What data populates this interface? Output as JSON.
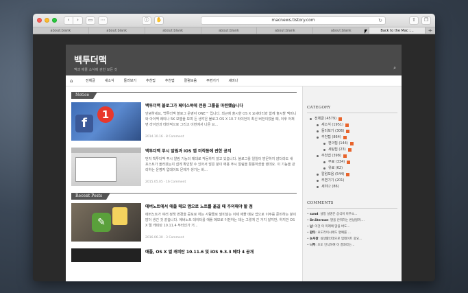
{
  "browser": {
    "address": "macnews.tistory.com",
    "tabs": [
      "about:blank",
      "about:blank",
      "about:blank",
      "about:blank",
      "about:blank",
      "about:blank",
      "Back to the Mac :..."
    ],
    "active_tab": 6
  },
  "site": {
    "title": "백투더맥",
    "subtitle": "맥과 애플 소식에 관한 모든 것",
    "nav": [
      "전체글",
      "새소식",
      "둘러보기",
      "추천팁",
      "추천앱",
      "칼럼모음",
      "주변기기",
      "세미나"
    ]
  },
  "notice": {
    "label": "Notice",
    "posts": [
      {
        "title": "백투더맥 블로그가 페이스북에 전용 그룹을 마련했습니다",
        "excerpt": "안녕하세요, 백투더맥 블로그 운영자 ONE™ 입니다. 최근에 출시한 OS X 요세미티와 함께 출시할 맥미니와 아이맥 레티나 5K 모델을 보며 든 생각은 블로그 OS X 10.7 라이언이 최신 버전이었을 때, 이후 어쩌면 라이언과 테마적으로 그리고 이번에서 나온 요...",
        "meta": "2014.10.16 · 8 Comment"
      },
      {
        "title": "백투더맥 푸시 알림과 iOS 앱 미작동에 관한 공지",
        "excerpt": "먼저 백투더맥 푸시 알림 기능의 제대로 작동하지 않고 있습니다. 블로그를 일일이 방문하지 않더라도 새 포스트가 올라왔는지 쉽게 확인할 수 있어서 많은 분이 애용 푸시 알림을 활용하셨을 텐데요. 이 기능을 관리하는 운영자 업데이트 문제가 생기는 바...",
        "meta": "2015.05.05 · 16 Comment"
      }
    ]
  },
  "recent": {
    "label": "Recent Posts",
    "posts": [
      {
        "title": "에버노트에서 애플 메모 앱으로 노트를 옮길 때 주의해야 할 점",
        "excerpt": "에버노트가 여러 정책 변경을 공포로 하는 사람들로 말미암는 이제 애플 메모 앱으로 이주를 준비하는 분이 많이 생긴 것 같습니다. 에버노트 데이터를 애플 메모로 이전하는 데는 그렇게 긴 거지 않지만, 하지만 OS X 엘 캐피탄 10.11.4 부터인가 거...",
        "meta": "2016.06.30 · 3 Comment"
      },
      {
        "title": "애플, OS X 엘 캐피탄 10.11.6 및 iOS 9.3.3 베타 4 공개",
        "excerpt": "",
        "meta": ""
      }
    ]
  },
  "sidebar": {
    "category_title": "CATEGORY",
    "categories": [
      {
        "label": "전체글 (4579)",
        "level": 1,
        "new": true
      },
      {
        "label": "새소식 (1951)",
        "level": 2,
        "new": true
      },
      {
        "label": "둘러보기 (306)",
        "level": 2,
        "new": true
      },
      {
        "label": "추천팁 (864)",
        "level": 2,
        "new": true
      },
      {
        "label": "편의팁 (144)",
        "level": 3,
        "new": true
      },
      {
        "label": "세팅팁 (23)",
        "level": 3,
        "new": true
      },
      {
        "label": "추천앱 (398)",
        "level": 2,
        "new": true
      },
      {
        "label": "무료 (334)",
        "level": 3,
        "new": true
      },
      {
        "label": "유료 (62)",
        "level": 3,
        "new": false
      },
      {
        "label": "칼럼모음 (544)",
        "level": 2,
        "new": true
      },
      {
        "label": "주변기기 (201)",
        "level": 2,
        "new": false
      },
      {
        "label": "세미나 (86)",
        "level": 2,
        "new": false
      }
    ],
    "comments_title": "COMMENTS",
    "comments": [
      {
        "author": "sund",
        "text": "설정 설명은 상식이 아주소..."
      },
      {
        "author": "Dr.Sternae",
        "text": "말을 안뭐하는 반납할까...."
      },
      {
        "author": "남",
        "text": "이것 이 미래에 맞을 바도..."
      },
      {
        "author": "판타",
        "text": "요도라이시에도 명예를 ..."
      },
      {
        "author": "논서왕",
        "text": "실생활인데으로 업데이트 중요..."
      },
      {
        "author": "나무",
        "text": "초도 인식하여 이 결과라는..."
      }
    ]
  }
}
